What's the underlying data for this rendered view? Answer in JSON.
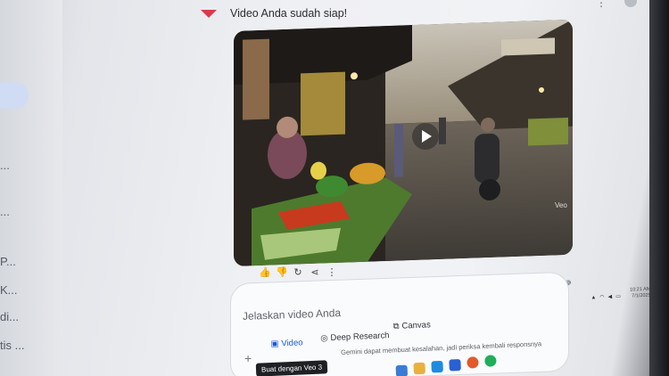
{
  "header": {
    "status_text": "Video Anda sudah siap!"
  },
  "video": {
    "watermark": "Veo"
  },
  "composer": {
    "placeholder": "Jelaskan video Anda",
    "tools": {
      "video_label": "Video",
      "deep_research_label": "Deep Research",
      "canvas_label": "Canvas"
    },
    "tooltip": "Buat dengan Veo 3",
    "disclaimer": "Gemini dapat membuat kesalahan, jadi periksa kembali responsnya"
  },
  "sidebar": {
    "ellipsis_items": [
      "...",
      "...",
      "P...",
      "K...",
      "di...",
      "tis ..."
    ]
  },
  "taskbar": {
    "time": "10:21 AM",
    "date": "7/1/2025"
  },
  "colors": {
    "accent": "#d83a4a",
    "composer_bg": "#fafbfc",
    "sidebar_highlight": "#cfdcf3"
  }
}
